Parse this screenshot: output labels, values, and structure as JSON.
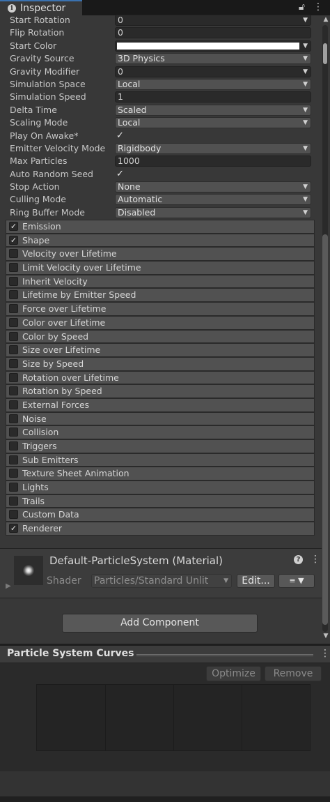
{
  "tab": {
    "title": "Inspector",
    "lock_icon": "lock-icon",
    "menu_icon": "kebab-menu-icon"
  },
  "properties": [
    {
      "label": "Start Rotation",
      "kind": "field-dropdown",
      "value": "0"
    },
    {
      "label": "Flip Rotation",
      "kind": "field",
      "value": "0"
    },
    {
      "label": "Start Color",
      "kind": "color",
      "value": "#ffffff"
    },
    {
      "label": "Gravity Source",
      "kind": "dropdown",
      "value": "3D Physics"
    },
    {
      "label": "Gravity Modifier",
      "kind": "field-dropdown",
      "value": "0"
    },
    {
      "label": "Simulation Space",
      "kind": "dropdown",
      "value": "Local"
    },
    {
      "label": "Simulation Speed",
      "kind": "field",
      "value": "1"
    },
    {
      "label": "Delta Time",
      "kind": "dropdown",
      "value": "Scaled"
    },
    {
      "label": "Scaling Mode",
      "kind": "dropdown",
      "value": "Local"
    },
    {
      "label": "Play On Awake*",
      "kind": "check",
      "value": "✓"
    },
    {
      "label": "Emitter Velocity Mode",
      "kind": "dropdown",
      "value": "Rigidbody"
    },
    {
      "label": "Max Particles",
      "kind": "field",
      "value": "1000"
    },
    {
      "label": "Auto Random Seed",
      "kind": "check",
      "value": "✓"
    },
    {
      "label": "Stop Action",
      "kind": "dropdown",
      "value": "None"
    },
    {
      "label": "Culling Mode",
      "kind": "dropdown",
      "value": "Automatic"
    },
    {
      "label": "Ring Buffer Mode",
      "kind": "dropdown",
      "value": "Disabled"
    }
  ],
  "modules": [
    {
      "label": "Emission",
      "checked": true
    },
    {
      "label": "Shape",
      "checked": true
    },
    {
      "label": "Velocity over Lifetime",
      "checked": false
    },
    {
      "label": "Limit Velocity over Lifetime",
      "checked": false
    },
    {
      "label": "Inherit Velocity",
      "checked": false
    },
    {
      "label": "Lifetime by Emitter Speed",
      "checked": false
    },
    {
      "label": "Force over Lifetime",
      "checked": false
    },
    {
      "label": "Color over Lifetime",
      "checked": false
    },
    {
      "label": "Color by Speed",
      "checked": false
    },
    {
      "label": "Size over Lifetime",
      "checked": false
    },
    {
      "label": "Size by Speed",
      "checked": false
    },
    {
      "label": "Rotation over Lifetime",
      "checked": false
    },
    {
      "label": "Rotation by Speed",
      "checked": false
    },
    {
      "label": "External Forces",
      "checked": false
    },
    {
      "label": "Noise",
      "checked": false
    },
    {
      "label": "Collision",
      "checked": false
    },
    {
      "label": "Triggers",
      "checked": false
    },
    {
      "label": "Sub Emitters",
      "checked": false
    },
    {
      "label": "Texture Sheet Animation",
      "checked": false
    },
    {
      "label": "Lights",
      "checked": false
    },
    {
      "label": "Trails",
      "checked": false
    },
    {
      "label": "Custom Data",
      "checked": false
    },
    {
      "label": "Renderer",
      "checked": true
    }
  ],
  "material": {
    "title": "Default-ParticleSystem (Material)",
    "shader_label": "Shader",
    "shader_value": "Particles/Standard Unlit",
    "edit_label": "Edit...",
    "list_icon": "≡",
    "help_icon": "?"
  },
  "add_component_label": "Add Component",
  "curves": {
    "title": "Particle System Curves",
    "optimize_label": "Optimize",
    "remove_label": "Remove"
  }
}
